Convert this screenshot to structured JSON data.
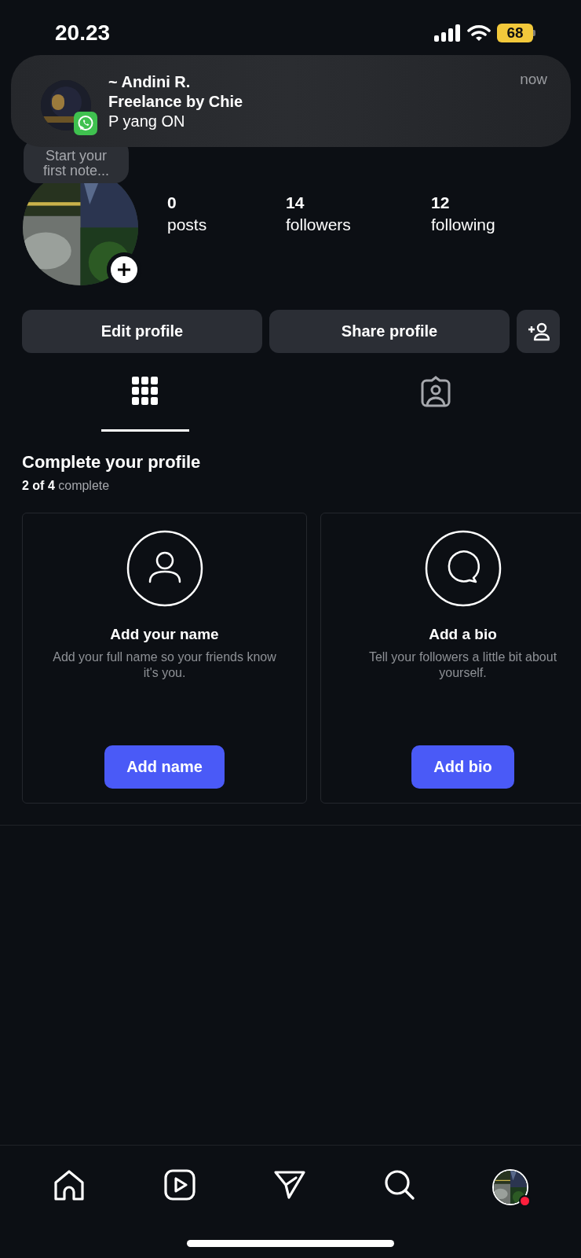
{
  "status_bar": {
    "time": "20.23",
    "battery": "68"
  },
  "notification": {
    "sender": "~ Andini R.",
    "group": "Freelance by Chie",
    "message": "P yang ON",
    "time": "now"
  },
  "profile": {
    "note_placeholder": "Start your\nfirst note...",
    "stats": [
      {
        "value": "0",
        "label": "posts"
      },
      {
        "value": "14",
        "label": "followers"
      },
      {
        "value": "12",
        "label": "following"
      }
    ]
  },
  "actions": [
    "Edit profile",
    "Share profile"
  ],
  "tabs": [
    {
      "kind": "grid",
      "selected": true
    },
    {
      "kind": "tagged",
      "selected": false
    }
  ],
  "complete_profile": {
    "title": "Complete your profile",
    "progress": "**2 of 4** complete",
    "cards": [
      {
        "kind": "name",
        "title": "Add your name",
        "text": "Add your full name so your friends know it's you.",
        "button": "Add name"
      },
      {
        "kind": "bio",
        "title": "Add a bio",
        "text": "Tell your followers a little bit about yourself.",
        "button": "Add bio"
      }
    ]
  },
  "bottom_nav": [
    {
      "kind": "home"
    },
    {
      "kind": "reels"
    },
    {
      "kind": "messages"
    },
    {
      "kind": "search"
    },
    {
      "kind": "profile",
      "activity": true
    }
  ]
}
